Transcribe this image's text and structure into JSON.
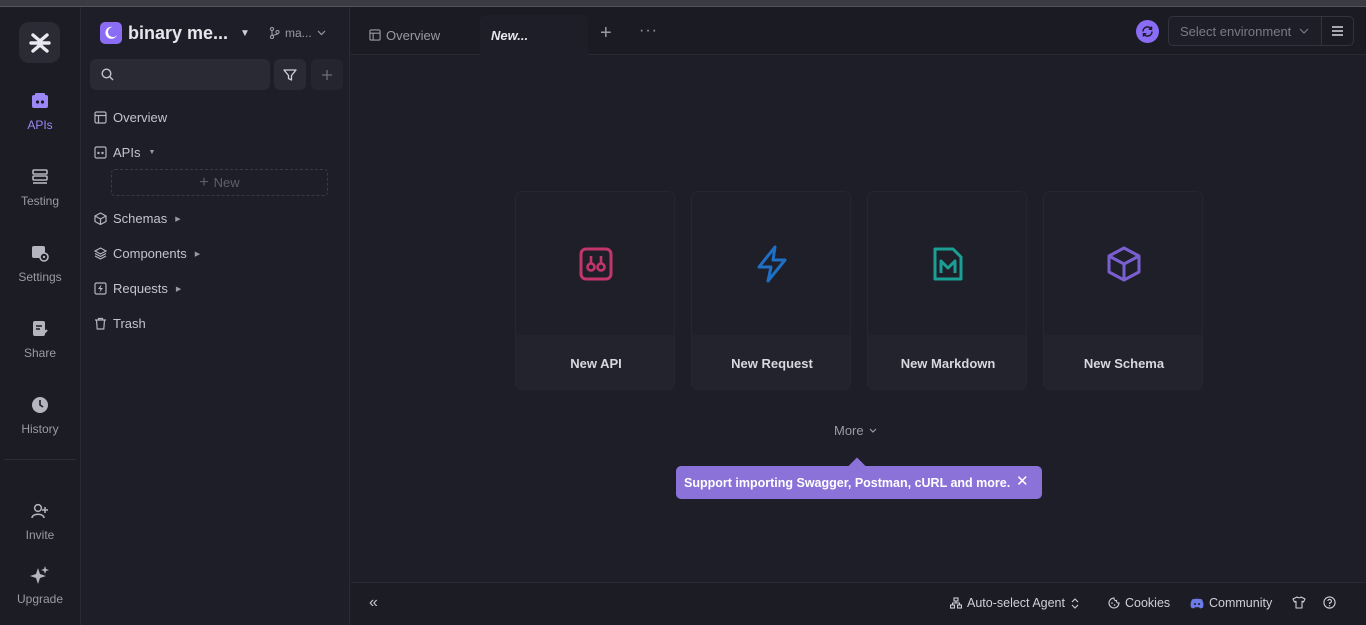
{
  "rail": {
    "items": [
      {
        "label": "APIs",
        "icon": "apis-icon",
        "active": true
      },
      {
        "label": "Testing",
        "icon": "testing-icon"
      },
      {
        "label": "Settings",
        "icon": "settings-icon"
      },
      {
        "label": "Share",
        "icon": "share-icon"
      },
      {
        "label": "History",
        "icon": "history-icon"
      },
      {
        "label": "Invite",
        "icon": "invite-icon"
      },
      {
        "label": "Upgrade",
        "icon": "sparkles-icon"
      }
    ]
  },
  "sidebar": {
    "project_name": "binary me...",
    "branch": "ma...",
    "search_placeholder": "",
    "tree": [
      {
        "label": "Overview",
        "icon": "overview-icon"
      },
      {
        "label": "APIs",
        "icon": "api-folder-icon"
      },
      {
        "label": "Schemas",
        "icon": "cube-icon"
      },
      {
        "label": "Components",
        "icon": "layers-icon"
      },
      {
        "label": "Requests",
        "icon": "bolt-icon"
      },
      {
        "label": "Trash",
        "icon": "trash-icon"
      }
    ],
    "new_label": "New"
  },
  "tabs": {
    "overview_label": "Overview",
    "active_label": "New..."
  },
  "header": {
    "environment_placeholder": "Select environment"
  },
  "cards": [
    {
      "label": "New API",
      "icon": "api-icon",
      "color": "#c2366b"
    },
    {
      "label": "New Request",
      "icon": "bolt-icon",
      "color": "#1f6fc5"
    },
    {
      "label": "New Markdown",
      "icon": "markdown-icon",
      "color": "#1b9e94"
    },
    {
      "label": "New Schema",
      "icon": "cube-icon",
      "color": "#7a5fd0"
    }
  ],
  "more_label": "More",
  "tip_text": "Support importing Swagger, Postman, cURL and more.",
  "statusbar": {
    "agent": "Auto-select Agent",
    "cookies": "Cookies",
    "community": "Community"
  },
  "colors": {
    "accent": "#8a6cf5",
    "tip_bg": "#8a72d8",
    "background": "#1e1e28"
  }
}
